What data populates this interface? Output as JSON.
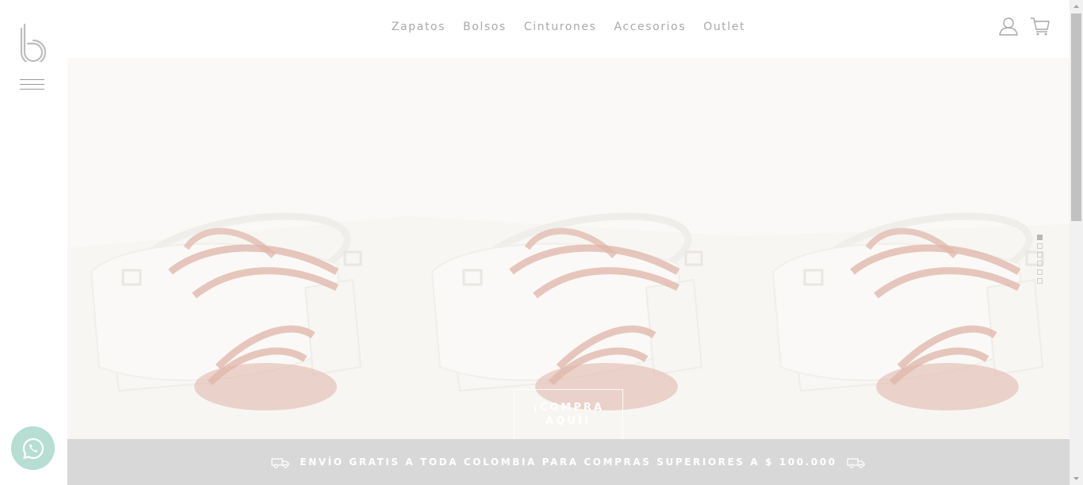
{
  "brand": {
    "logo_letter": "b"
  },
  "nav": {
    "items": [
      {
        "label": "Zapatos"
      },
      {
        "label": "Bolsos"
      },
      {
        "label": "Cinturones"
      },
      {
        "label": "Accesorios"
      },
      {
        "label": "Outlet"
      }
    ]
  },
  "header_icons": {
    "account": "user-icon",
    "cart": "shopping-cart-icon"
  },
  "hero": {
    "cta_label": "¡COMPRA AQUÍ!",
    "slide_count": 6,
    "active_slide": 1
  },
  "shipping_bar": {
    "text": "ENVÍO GRATIS A TODA COLOMBIA PARA COMPRAS SUPERIORES A $ 100.000",
    "icon": "truck-icon"
  },
  "whatsapp": {
    "icon": "whatsapp-icon",
    "color": "#b6ded2"
  },
  "colors": {
    "nav_text": "#a9a9a9",
    "shipping_bar_bg": "#d8d8d8",
    "strap_red": "#c9806a"
  }
}
